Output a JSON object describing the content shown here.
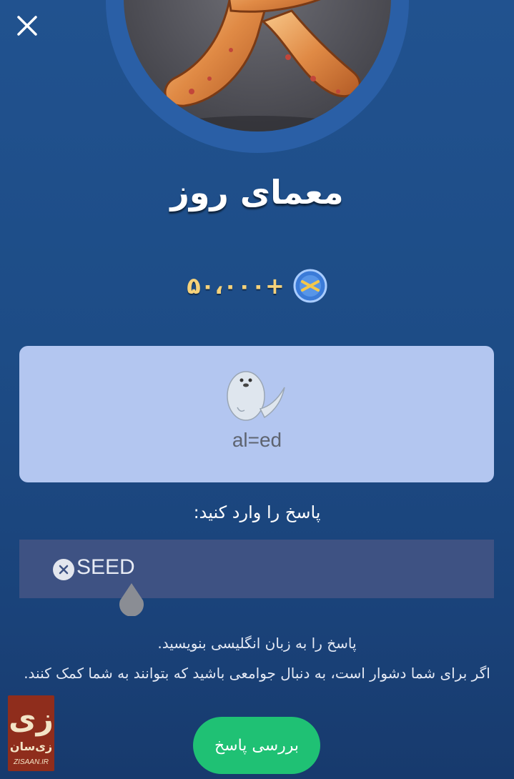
{
  "header": {
    "close_icon": "close-icon"
  },
  "hero": {
    "letter": "R",
    "image_desc": "glossy-orange-letter"
  },
  "title": "معمای روز",
  "reward": {
    "text": "+۵۰،۰۰۰",
    "icon": "coin-icon"
  },
  "puzzle": {
    "icon": "seal-icon",
    "text": "al=ed"
  },
  "answer": {
    "prompt": "پاسخ را وارد کنید:",
    "value": "SEED",
    "clear_icon": "clear-circle-icon"
  },
  "hints": {
    "line1": "پاسخ را به زبان انگلیسی بنویسید.",
    "line2": "اگر برای شما دشوار است، به دنبال جوامعی باشید که بتوانند به شما کمک کنند."
  },
  "check_button": {
    "label": "بررسی پاسخ"
  },
  "watermark": {
    "mark": "زی",
    "name": "زی‌سان",
    "domain": "ZISAAN.IR"
  },
  "colors": {
    "background": "#1d4c86",
    "accent_gold": "#f6d27a",
    "card": "#b3c6f0",
    "input": "#3e5283",
    "button": "#1fc174"
  }
}
